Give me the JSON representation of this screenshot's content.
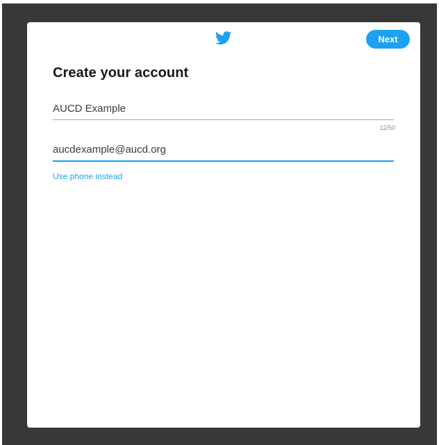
{
  "header": {
    "logo_icon": "twitter-bird-icon",
    "next_label": "Next"
  },
  "form": {
    "title": "Create your account",
    "name_value": "AUCD Example",
    "name_counter": "12/50",
    "email_value": "aucdexample@aucd.org",
    "use_phone_label": "Use phone instead"
  },
  "colors": {
    "accent": "#1da1f2",
    "backdrop": "#383838",
    "modal": "#ffffff"
  }
}
